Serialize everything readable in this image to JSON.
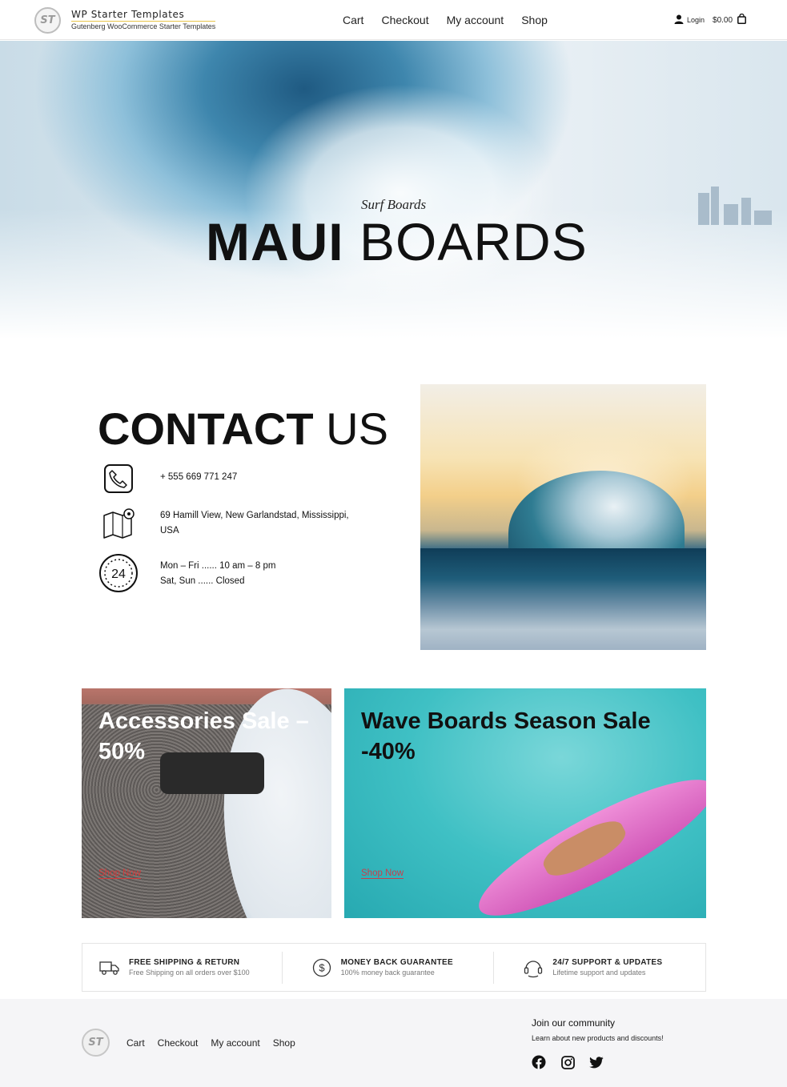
{
  "header": {
    "brand_title": "WP Starter Templates",
    "brand_subtitle": "Gutenberg WooCommerce Starter Templates",
    "logo_text": "ST",
    "nav": [
      "Cart",
      "Checkout",
      "My account",
      "Shop"
    ],
    "login_label": "Login",
    "cart_total": "$0.00"
  },
  "hero": {
    "kicker": "Surf Boards",
    "title_bold": "MAUI",
    "title_light": "BOARDS"
  },
  "contact": {
    "title_bold": "CONTACT",
    "title_light": "US",
    "phone": "+ 555 669 771 247",
    "address_line1": "69 Hamill View, New Garlandstad, Mississippi,",
    "address_line2": "USA",
    "hours_line1": "Mon – Fri ...... 10 am – 8 pm",
    "hours_line2": "Sat, Sun ...... Closed",
    "hours_badge": "24"
  },
  "promos": [
    {
      "title": "Accessories Sale – 50%",
      "link": "Shop Now"
    },
    {
      "title": "Wave Boards Season Sale -40%",
      "link": "Shop Now"
    }
  ],
  "features": [
    {
      "title": "FREE SHIPPING & RETURN",
      "subtitle": "Free Shipping on all orders over $100",
      "icon": "truck-icon"
    },
    {
      "title": "MONEY BACK GUARANTEE",
      "subtitle": "100% money back guarantee",
      "icon": "dollar-coin-icon"
    },
    {
      "title": "24/7 SUPPORT & UPDATES",
      "subtitle": "Lifetime support and updates",
      "icon": "support-headset-icon"
    }
  ],
  "footer": {
    "logo_text": "ST",
    "nav": [
      "Cart",
      "Checkout",
      "My account",
      "Shop"
    ],
    "join_title": "Join our community",
    "join_subtitle": "Learn about new products and discounts!",
    "socials": [
      "facebook-icon",
      "instagram-icon",
      "twitter-icon"
    ]
  },
  "colors": {
    "link_red": "#d43a3a",
    "tile_teal": "#3fc0c4",
    "footer_bg": "#f5f5f7"
  }
}
